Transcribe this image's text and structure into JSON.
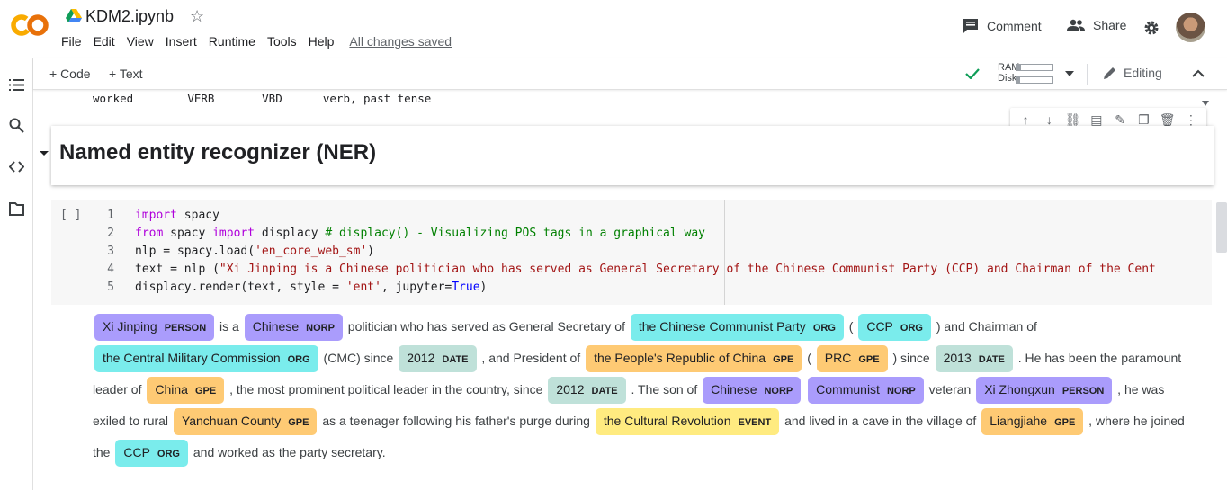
{
  "app": {
    "logo": "CO",
    "notebook_title": "KDM2.ipynb",
    "menu": [
      "File",
      "Edit",
      "View",
      "Insert",
      "Runtime",
      "Tools",
      "Help"
    ],
    "save_status": "All changes saved",
    "comment_label": "Comment",
    "share_label": "Share"
  },
  "toolbar": {
    "add_code": "+ Code",
    "add_text": "+ Text",
    "ram_label": "RAM",
    "disk_label": "Disk",
    "ram_usage": 0.12,
    "disk_usage": 0.1,
    "editing_label": "Editing"
  },
  "previous_output": {
    "line": "worked        VERB       VBD      verb, past tense"
  },
  "text_cell": {
    "heading": "Named entity recognizer (NER)"
  },
  "code_cell": {
    "run_bracket": "[ ]",
    "line_numbers": [
      "1",
      "2",
      "3",
      "4",
      "5"
    ]
  },
  "ner_output": {
    "segments": [
      {
        "text": "Xi Jinping",
        "label": "PERSON"
      },
      {
        "text": " is a "
      },
      {
        "text": "Chinese",
        "label": "NORP"
      },
      {
        "text": " politician who has served as General Secretary of "
      },
      {
        "text": "the Chinese Communist Party",
        "label": "ORG"
      },
      {
        "text": " ( "
      },
      {
        "text": "CCP",
        "label": "ORG"
      },
      {
        "text": " ) and Chairman of "
      },
      {
        "text": "the Central Military Commission",
        "label": "ORG"
      },
      {
        "text": " (CMC) since "
      },
      {
        "text": "2012",
        "label": "DATE"
      },
      {
        "text": " , and President of "
      },
      {
        "text": "the People's Republic of China",
        "label": "GPE"
      },
      {
        "text": " ( "
      },
      {
        "text": "PRC",
        "label": "GPE"
      },
      {
        "text": " ) since "
      },
      {
        "text": "2013",
        "label": "DATE"
      },
      {
        "text": " . He has been the paramount leader of "
      },
      {
        "text": "China",
        "label": "GPE"
      },
      {
        "text": " , the most prominent political leader in the country, since "
      },
      {
        "text": "2012",
        "label": "DATE"
      },
      {
        "text": " . The son of "
      },
      {
        "text": "Chinese",
        "label": "NORP"
      },
      {
        "text": " "
      },
      {
        "text": "Communist",
        "label": "NORP"
      },
      {
        "text": " veteran "
      },
      {
        "text": "Xi Zhongxun",
        "label": "PERSON"
      },
      {
        "text": " , he was exiled to rural "
      },
      {
        "text": "Yanchuan County",
        "label": "GPE"
      },
      {
        "text": " as a teenager following his father's purge during "
      },
      {
        "text": "the Cultural Revolution",
        "label": "EVENT"
      },
      {
        "text": " and lived in a cave in the village of "
      },
      {
        "text": "Liangjiahe",
        "label": "GPE"
      },
      {
        "text": " , where he joined the "
      },
      {
        "text": "CCP",
        "label": "ORG"
      },
      {
        "text": " and worked as the party secretary."
      }
    ]
  }
}
